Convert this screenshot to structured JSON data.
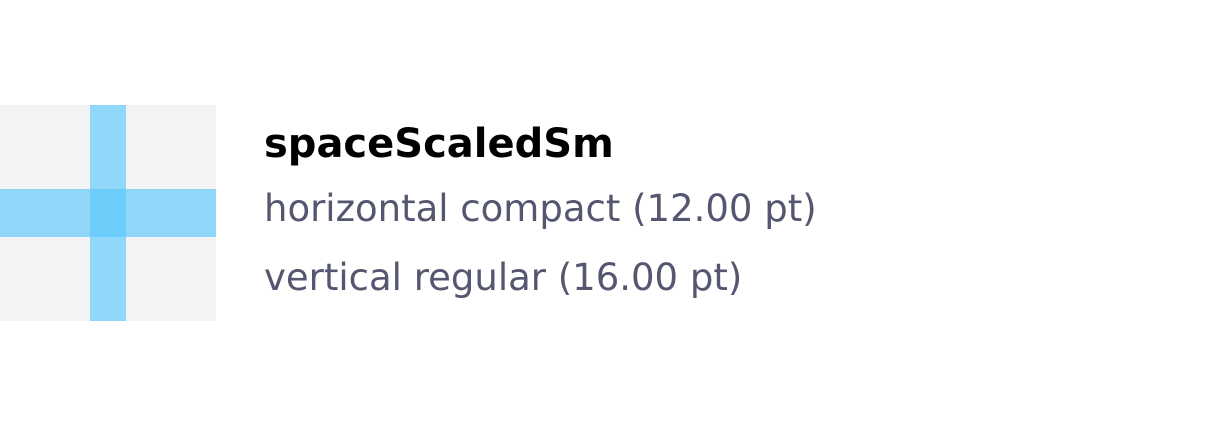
{
  "token": {
    "name": "spaceScaledSm",
    "horizontal": "horizontal compact (12.00 pt)",
    "vertical": "vertical regular (16.00 pt)"
  },
  "colors": {
    "swatch_background": "#f3f3f5",
    "spacing_bar": "#5ac8fa",
    "title_text": "#000000",
    "detail_text": "#555770"
  },
  "icons": {
    "preview": "spacing-cross-icon"
  }
}
